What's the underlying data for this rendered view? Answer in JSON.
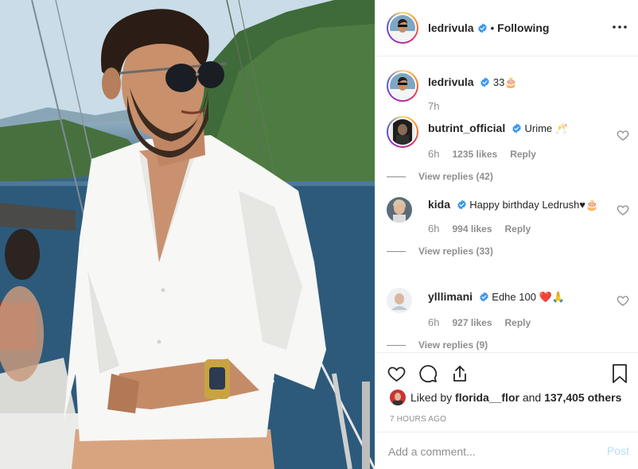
{
  "photo": {
    "icon": "post-photo-man-on-sailboat"
  },
  "header": {
    "username": "ledrivula",
    "separator": "•",
    "follow_status": "Following",
    "more_icon": "more-horizontal-icon"
  },
  "caption": {
    "username": "ledrivula",
    "text": "33🎂",
    "time": "7h"
  },
  "comments": [
    {
      "username": "butrint_official",
      "text": "Urime 🥂",
      "time": "6h",
      "likes": "1235 likes",
      "reply": "Reply",
      "view_replies": "View replies (42)"
    },
    {
      "username": "kida",
      "text": "Happy birthday Ledrush♥🎂",
      "time": "6h",
      "likes": "994 likes",
      "reply": "Reply",
      "view_replies": "View replies (33)"
    },
    {
      "username": "ylllimani",
      "text": "Edhe 100 ❤️🙏",
      "time": "6h",
      "likes": "927 likes",
      "reply": "Reply",
      "view_replies": "View replies (9)"
    }
  ],
  "likes": {
    "prefix": "Liked by ",
    "user": "florida__flor",
    "middle": " and ",
    "count": "137,405 others"
  },
  "timestamp": "7 HOURS AGO",
  "add_comment": {
    "placeholder": "Add a comment...",
    "post_label": "Post"
  },
  "colors": {
    "verified": "#3897f0",
    "post_disabled": "#b2dffc",
    "muted": "#8e8e8e"
  }
}
